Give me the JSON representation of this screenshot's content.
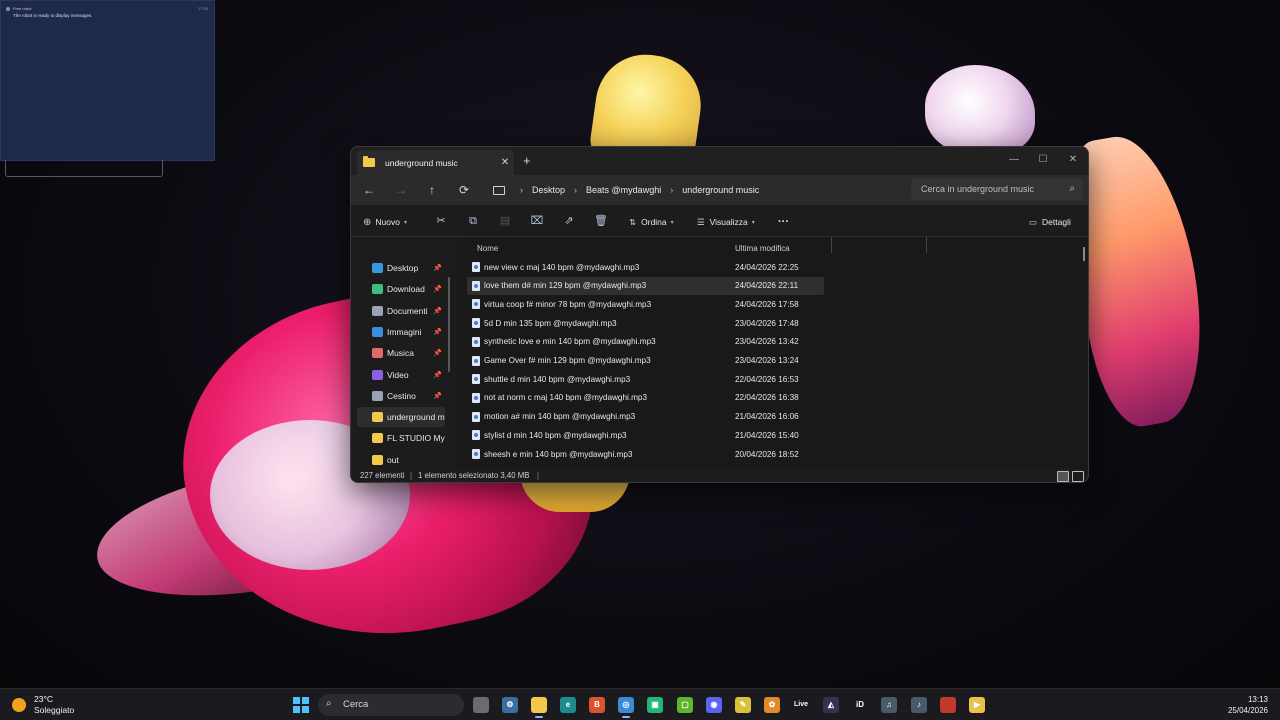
{
  "message_window": {
    "sender": "Free robot",
    "time": "17:55",
    "text": "The robot is ready to display messages."
  },
  "explorer": {
    "tab_title": "underground music",
    "tab_close": "✕",
    "new_tab": "+",
    "window_controls": {
      "minimize": "—",
      "maximize": "☐",
      "close": "✕"
    },
    "nav": {
      "back": "←",
      "forward": "→",
      "up": "↑",
      "refresh": "⟳"
    },
    "breadcrumb": [
      "Desktop",
      "Beats @mydawghi",
      "underground music"
    ],
    "breadcrumb_sep": "›",
    "search_placeholder": "Cerca in underground music",
    "toolbar": {
      "new_label": "Nuovo",
      "sort_label": "Ordina",
      "view_label": "Visualizza",
      "more": "···",
      "details_label": "Dettagli"
    },
    "nav_pane": [
      {
        "label": "Desktop",
        "color": "#3a96dd",
        "pinned": true
      },
      {
        "label": "Download",
        "color": "#3fbf7f",
        "pinned": true
      },
      {
        "label": "Documenti",
        "color": "#9aa3b5",
        "pinned": true
      },
      {
        "label": "Immagini",
        "color": "#3a8fdd",
        "pinned": true
      },
      {
        "label": "Musica",
        "color": "#e06a6a",
        "pinned": true
      },
      {
        "label": "Video",
        "color": "#8a5fe0",
        "pinned": true
      },
      {
        "label": "Cestino",
        "color": "#9aa3b5",
        "pinned": true
      },
      {
        "label": "underground m",
        "color": "#f2c94c",
        "pinned": false
      },
      {
        "label": "FL STUDIO My D",
        "color": "#f2c94c",
        "pinned": false
      },
      {
        "label": "out",
        "color": "#f2c94c",
        "pinned": false
      }
    ],
    "columns": {
      "name": "Nome",
      "modified": "Ultima modifica"
    },
    "files": [
      {
        "name": "new view c maj 140 bpm @mydawghi.mp3",
        "date": "24/04/2026 22:25"
      },
      {
        "name": "love them d# min 129 bpm @mydawghi.mp3",
        "date": "24/04/2026 22:11"
      },
      {
        "name": "virtua coop f# minor 78 bpm @mydawghi.mp3",
        "date": "24/04/2026 17:58"
      },
      {
        "name": "5d D min 135 bpm @mydawghi.mp3",
        "date": "23/04/2026 17:48"
      },
      {
        "name": "synthetic love e min 140 bpm @mydawghi.mp3",
        "date": "23/04/2026 13:42"
      },
      {
        "name": "Game Over f# min 129 bpm @mydawghi.mp3",
        "date": "23/04/2026 13:24"
      },
      {
        "name": "shuttle d min 140 bpm @mydawghi.mp3",
        "date": "22/04/2026 16:53"
      },
      {
        "name": "not at norm c maj 140 bpm @mydawghi.mp3",
        "date": "22/04/2026 16:38"
      },
      {
        "name": "motion a# min 140 bpm @mydawghi.mp3",
        "date": "21/04/2026 16:06"
      },
      {
        "name": "stylist d min 140 bpm @mydawghi.mp3",
        "date": "21/04/2026 15:40"
      },
      {
        "name": "sheesh e min 140 bpm @mydawghi.mp3",
        "date": "20/04/2026 18:52"
      }
    ],
    "selected_file_index": 1,
    "status": {
      "count": "227 elementi",
      "selection": "1 elemento selezionato  3,40 MB"
    }
  },
  "taskbar": {
    "temperature": "23°C",
    "condition": "Soleggiato",
    "search_label": "Cerca",
    "time": "13:13",
    "date": "25/04/2026",
    "live_label": "Live",
    "id_label": "iD"
  }
}
